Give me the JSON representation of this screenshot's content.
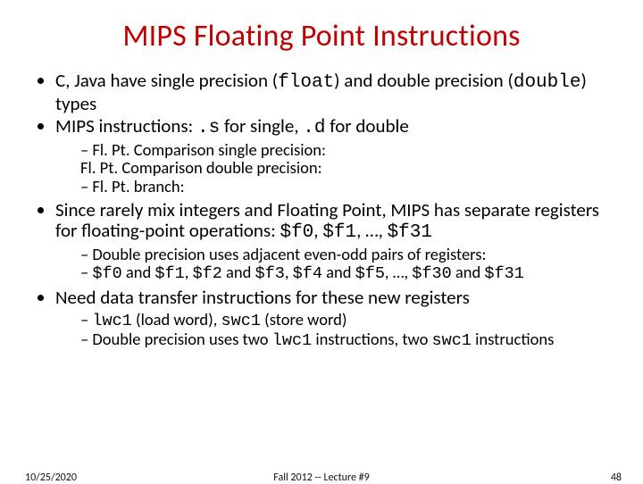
{
  "title": "MIPS Floating Point Instructions",
  "b1": {
    "pre": "C, Java have single precision (",
    "float": "float",
    "mid": ") and double precision (",
    "double": "double",
    "post": ") types"
  },
  "b2": {
    "pre": "MIPS instructions:  ",
    "s": ".s",
    "mid": " for single,  ",
    "d": ".d",
    "post": " for double"
  },
  "b2s1a": "Fl. Pt. Comparison single precision:",
  "b2s1b": "Fl. Pt. Comparison double precision:",
  "b2s2": "Fl. Pt. branch:",
  "b3": {
    "pre": "Since rarely mix integers and Floating Point, MIPS has separate registers for floating-point operations: ",
    "f0": "$f0",
    "c1": ", ",
    "f1": "$f1",
    "c2": ", …, ",
    "f31": "$f31"
  },
  "b3s1": "Double precision uses adjacent even-odd pairs of registers:",
  "b3s2": {
    "f0": "$f0",
    "a1": " and ",
    "f1": "$f1",
    "c1": ", ",
    "f2": "$f2",
    "a2": "  and ",
    "f3": "$f3",
    "c2": ", ",
    "f4": "$f4",
    "a3": " and ",
    "f5": "$f5",
    "c3": ", …, ",
    "f30": "$f30",
    "a4": " and ",
    "f31": "$f31"
  },
  "b4": "Need data transfer instructions for these new registers",
  "b4s1": {
    "lwc1": "lwc1",
    "lw": " (load word), ",
    "swc1": "swc1",
    "sw": " (store word)"
  },
  "b4s2": {
    "pre": "Double precision uses two ",
    "lwc1": "lwc1",
    "mid": " instructions, two ",
    "swc1": "swc1",
    "post": " instructions"
  },
  "footer": {
    "date": "10/25/2020",
    "center": "Fall 2012 -- Lecture #9",
    "page": "48"
  }
}
